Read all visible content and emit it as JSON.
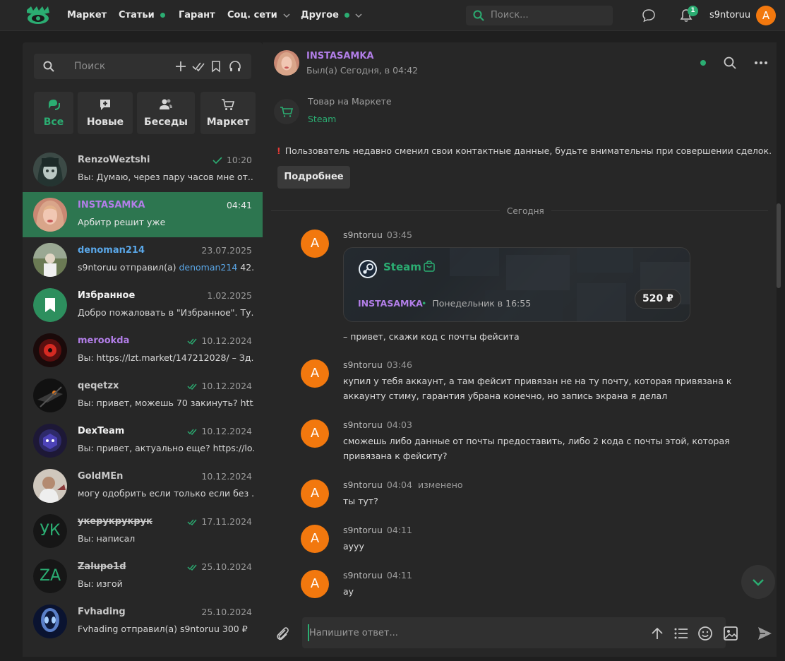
{
  "topnav": {
    "logo": "eye-crown-logo",
    "items": [
      {
        "label": "Маркет",
        "dot": false,
        "chevron": false
      },
      {
        "label": "Статьи",
        "dot": true,
        "chevron": false
      },
      {
        "label": "Гарант",
        "dot": false,
        "chevron": false
      },
      {
        "label": "Соц. сети",
        "dot": false,
        "chevron": true
      },
      {
        "label": "Другое",
        "dot": true,
        "chevron": true
      }
    ],
    "search_placeholder": "Поиск...",
    "notification_count": "1",
    "username": "s9ntoruu",
    "avatar_letter": "A"
  },
  "sidebar": {
    "search_placeholder": "Поиск",
    "tabs": [
      {
        "label": "Все",
        "icon": "chat-bubbles-icon",
        "active": true
      },
      {
        "label": "Новые",
        "icon": "new-message-icon",
        "active": false
      },
      {
        "label": "Беседы",
        "icon": "group-icon",
        "active": false
      },
      {
        "label": "Маркет",
        "icon": "cart-icon",
        "active": false
      }
    ],
    "conversations": [
      {
        "name": "RenzoWeztshi",
        "time": "10:20",
        "read": true,
        "preview": "Вы: Думаю, через пару часов мне от...",
        "name_style": "default",
        "avatar": "anime-girl"
      },
      {
        "name": "INSTASAMKA",
        "time": "04:41",
        "read": false,
        "preview": "Арбитр решит уже",
        "name_style": "purple",
        "avatar": "photo-blonde",
        "active": true
      },
      {
        "name": "denoman214",
        "time": "23.07.2025",
        "read": false,
        "preview_parts": [
          "s9ntoruu отправил(а) ",
          "denoman214",
          " 42..."
        ],
        "name_style": "blue",
        "avatar": "photo-outdoor"
      },
      {
        "name": "Избранное",
        "time": "1.02.2025",
        "read": false,
        "preview": "Добро пожаловать в \"Избранное\". Ту...",
        "name_style": "white",
        "avatar": "bookmark"
      },
      {
        "name": "merookda",
        "time": "10.12.2024",
        "read": true,
        "preview": "Вы: https://lzt.market/147212028/ – Зд...",
        "name_style": "purple",
        "avatar": "red-eye"
      },
      {
        "name": "qeqetzx",
        "time": "10.12.2024",
        "read": true,
        "preview": "Вы: привет, можешь 70 закинуть? htt...",
        "name_style": "default",
        "avatar": "dark-gun"
      },
      {
        "name": "DexTeam",
        "time": "10.12.2024",
        "read": true,
        "preview": "Вы: привет, актуально еще? https://lo...",
        "name_style": "white",
        "avatar": "team-logo"
      },
      {
        "name": "GoldMEn",
        "time": "10.12.2024",
        "read": false,
        "preview": "могу одобрить если только если без ...",
        "name_style": "default",
        "avatar": "photo-man"
      },
      {
        "name": "укерукрукрук",
        "time": "17.11.2024",
        "read": true,
        "preview": "Вы: написал",
        "name_style": "strike",
        "avatar_initials": "УК"
      },
      {
        "name": "Zalupo1d",
        "time": "25.10.2024",
        "read": true,
        "preview": "Вы: изгой",
        "name_style": "strike",
        "avatar_initials": "ZA"
      },
      {
        "name": "Fvhading",
        "time": "25.10.2024",
        "read": false,
        "preview": "Fvhading отправил(а) s9ntoruu 300 ₽",
        "name_style": "default",
        "avatar": "alien"
      }
    ]
  },
  "chat": {
    "header": {
      "name": "INSTASAMKA",
      "status": "Был(а) Сегодня, в 04:42"
    },
    "market": {
      "label": "Товар на Маркете",
      "link": "Steam"
    },
    "warning": "Пользователь недавно сменил свои контактные данные, будьте внимательны при совершении сделок.",
    "more_button": "Подробнее",
    "separator": "Сегодня",
    "card": {
      "title": "Steam",
      "seller": "INSTASAMKA",
      "when": "Понедельник в 16:55",
      "price": "520 ₽"
    },
    "messages": [
      {
        "author": "s9ntoruu",
        "time": "03:45",
        "edited": "",
        "text": "– привет, скажи код с почты фейсита"
      },
      {
        "author": "s9ntoruu",
        "time": "03:46",
        "edited": "",
        "text": "купил у тебя аккаунт, а там фейсит привязан не на ту почту, которая привязана к аккаунту стиму, гарантия убрана конечно, но запись экрана я делал"
      },
      {
        "author": "s9ntoruu",
        "time": "04:03",
        "edited": "",
        "text": "сможешь либо данные от почты предоставить, либо 2 кода с почты этой, которая привязана к фейситу?"
      },
      {
        "author": "s9ntoruu",
        "time": "04:04",
        "edited": "изменено",
        "text": "ты тут?"
      },
      {
        "author": "s9ntoruu",
        "time": "04:11",
        "edited": "",
        "text": "аууу"
      },
      {
        "author": "s9ntoruu",
        "time": "04:11",
        "edited": "",
        "text": "ау"
      }
    ],
    "avatar_letter": "A",
    "composer_placeholder": "Напишите ответ..."
  },
  "colors": {
    "accent": "#2bad72",
    "purple": "#b27ee8",
    "blue": "#5aa7e8",
    "orange": "#f2780e",
    "active_row": "#2d7650",
    "warning": "#e53935"
  }
}
